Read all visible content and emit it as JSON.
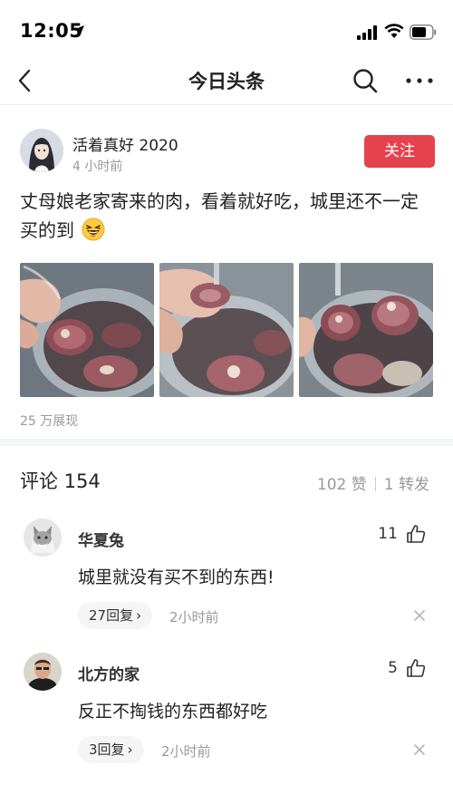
{
  "status_bar": {
    "time": "12:05"
  },
  "nav": {
    "title": "今日头条"
  },
  "post": {
    "author": "活着真好 2020",
    "time": "4 小时前",
    "follow_label": "关注",
    "text": "丈母娘老家寄来的肉，看着就好吃，城里还不一定买的到",
    "views": "25 万展现"
  },
  "comments_header": {
    "title": "评论 154",
    "likes": "102 赞",
    "shares": "1 转发"
  },
  "comments": [
    {
      "name": "华夏兔",
      "likes": "11",
      "text": "城里就没有买不到的东西!",
      "replies": "27回复",
      "time": "2小时前"
    },
    {
      "name": "北方的家",
      "likes": "5",
      "text": "反正不掏钱的东西都好吃",
      "replies": "3回复",
      "time": "2小时前"
    }
  ],
  "colors": {
    "accent": "#e5424d",
    "muted": "#999999",
    "divider": "#f4f5f6"
  }
}
